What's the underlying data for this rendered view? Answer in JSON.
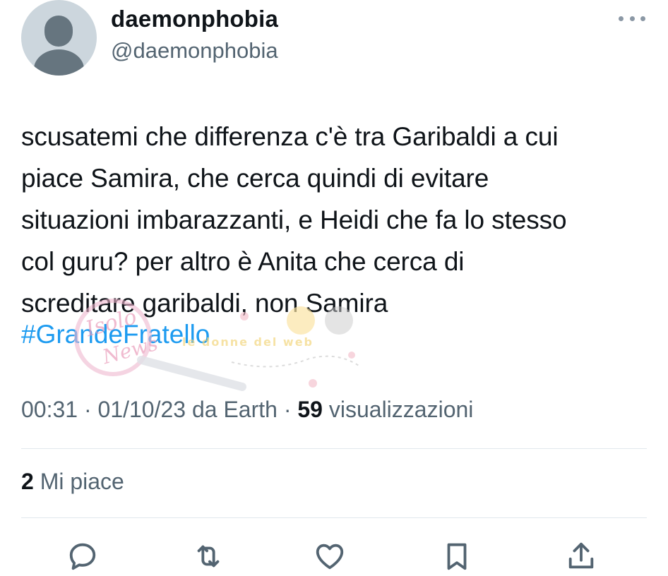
{
  "author": {
    "display_name": "daemonphobia",
    "handle": "@daemonphobia",
    "avatar_icon": "default-avatar-icon"
  },
  "tweet": {
    "text": "scusatemi che differenza c'è tra Garibaldi a cui\npiace Samira, che cerca quindi di evitare\nsituazioni imbarazzanti, e Heidi che fa lo stesso\ncol guru? per altro è Anita che cerca di\nscreditare garibaldi, non Samira",
    "hashtag": "#GrandeFratello"
  },
  "watermark": {
    "text_1": "Isolo",
    "text_2": "News",
    "text_3": "le donne del web"
  },
  "meta": {
    "time": "00:31",
    "sep1": " · ",
    "date": "01/10/23",
    "source": " da Earth",
    "sep2": " · ",
    "views_count": "59",
    "views_label": " visualizzazioni"
  },
  "stats": {
    "likes_count": "2",
    "likes_label": " Mi piace"
  },
  "actions": [
    {
      "name": "reply",
      "icon": "reply-icon"
    },
    {
      "name": "retweet",
      "icon": "retweet-icon"
    },
    {
      "name": "like",
      "icon": "heart-icon"
    },
    {
      "name": "bookmark",
      "icon": "bookmark-icon"
    },
    {
      "name": "share",
      "icon": "share-icon"
    }
  ],
  "colors": {
    "link": "#1d9bf0",
    "secondary_text": "#536471",
    "icon": "#536471"
  }
}
